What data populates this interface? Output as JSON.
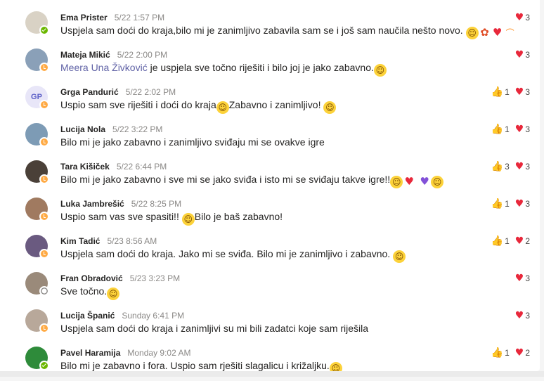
{
  "messages": [
    {
      "name": "Ema Prister",
      "time": "5/22 1:57 PM",
      "status": "available",
      "avatar_color": "#d9d2c5",
      "body": [
        {
          "t": "text",
          "v": "Uspjela sam doći do kraja,bilo mi je zanimljivo zabavila sam se i još sam naučila nešto novo. "
        },
        {
          "t": "emoji",
          "icon": "slightly-smiling-face-emoji",
          "glyph": "☺",
          "cls": "smile"
        },
        {
          "t": "emoji",
          "icon": "flower-emoji",
          "glyph": "✿",
          "cls": "flower"
        },
        {
          "t": "emoji",
          "icon": "heart-emoji",
          "glyph": "♥",
          "cls": "heart"
        },
        {
          "t": "emoji",
          "icon": "rainbow-emoji",
          "glyph": "⌒",
          "cls": "rainbow"
        }
      ],
      "reactions": [
        {
          "type": "heart",
          "count": "3"
        }
      ]
    },
    {
      "name": "Mateja Mikić",
      "time": "5/22 2:00 PM",
      "status": "away",
      "avatar_color": "#8aa0b8",
      "body": [
        {
          "t": "mention",
          "v": "Meera Una Živković"
        },
        {
          "t": "text",
          "v": " je uspjela sve točno riješiti i bilo joj je jako zabavno."
        },
        {
          "t": "emoji",
          "icon": "slightly-smiling-face-emoji",
          "glyph": "☺",
          "cls": "smile"
        }
      ],
      "reactions": [
        {
          "type": "heart",
          "count": "3"
        }
      ]
    },
    {
      "name": "Grga Pandurić",
      "time": "5/22 2:02 PM",
      "status": "away",
      "avatar_initials": "GP",
      "avatar_color": "#e8e6f8",
      "body": [
        {
          "t": "text",
          "v": "Uspio sam sve riješiti i doći do kraja"
        },
        {
          "t": "emoji",
          "icon": "slightly-smiling-face-emoji",
          "glyph": "☺",
          "cls": "smile"
        },
        {
          "t": "text",
          "v": "Zabavno i zanimljivo! "
        },
        {
          "t": "emoji",
          "icon": "slightly-smiling-face-emoji",
          "glyph": "☺",
          "cls": "smile"
        }
      ],
      "reactions": [
        {
          "type": "like",
          "count": "1"
        },
        {
          "type": "heart",
          "count": "3"
        }
      ]
    },
    {
      "name": "Lucija Nola",
      "time": "5/22 3:22 PM",
      "status": "away",
      "avatar_color": "#7d9bb5",
      "body": [
        {
          "t": "text",
          "v": "Bilo mi je jako zabavno i zanimljivo sviđaju mi se ovakve igre"
        }
      ],
      "reactions": [
        {
          "type": "like",
          "count": "1"
        },
        {
          "type": "heart",
          "count": "3"
        }
      ]
    },
    {
      "name": "Tara Kišiček",
      "time": "5/22 6:44 PM",
      "status": "away",
      "avatar_color": "#4a4038",
      "body": [
        {
          "t": "text",
          "v": "Bilo mi je jako zabavno i sve mi se jako sviđa i isto mi se sviđaju takve igre!!"
        },
        {
          "t": "emoji",
          "icon": "smiling-face-with-halo-emoji",
          "glyph": "☺",
          "cls": "smile"
        },
        {
          "t": "emoji",
          "icon": "heart-with-ribbon-emoji",
          "glyph": "♥",
          "cls": "heart"
        },
        {
          "t": "text",
          "v": " "
        },
        {
          "t": "emoji",
          "icon": "purple-heart-emoji",
          "glyph": "♥",
          "cls": "purple"
        },
        {
          "t": "emoji",
          "icon": "smiling-face-with-halo-emoji",
          "glyph": "☺",
          "cls": "smile"
        }
      ],
      "reactions": [
        {
          "type": "like",
          "count": "3"
        },
        {
          "type": "heart",
          "count": "3"
        }
      ]
    },
    {
      "name": "Luka Jambrešić",
      "time": "5/22 8:25 PM",
      "status": "away",
      "avatar_color": "#a07a60",
      "body": [
        {
          "t": "text",
          "v": "Uspio sam vas sve spasiti!! "
        },
        {
          "t": "emoji",
          "icon": "smiling-cat-face-emoji",
          "glyph": "☺",
          "cls": "smile"
        },
        {
          "t": "text",
          "v": "Bilo je baš zabavno!"
        }
      ],
      "reactions": [
        {
          "type": "like",
          "count": "1"
        },
        {
          "type": "heart",
          "count": "3"
        }
      ]
    },
    {
      "name": "Kim Tadić",
      "time": "5/23 8:56 AM",
      "status": "away",
      "avatar_color": "#6a5a80",
      "body": [
        {
          "t": "text",
          "v": "Uspjela sam doći do kraja. Jako mi se sviđa. Bilo mi je zanimljivo i zabavno. "
        },
        {
          "t": "emoji",
          "icon": "slightly-smiling-face-emoji",
          "glyph": "☺",
          "cls": "smile"
        }
      ],
      "reactions": [
        {
          "type": "like",
          "count": "1"
        },
        {
          "type": "heart",
          "count": "2"
        }
      ]
    },
    {
      "name": "Fran Obradović",
      "time": "5/23 3:23 PM",
      "status": "offline",
      "avatar_color": "#9a8a7a",
      "body": [
        {
          "t": "text",
          "v": "Sve točno."
        },
        {
          "t": "emoji",
          "icon": "slightly-smiling-face-emoji",
          "glyph": "☺",
          "cls": "smile"
        }
      ],
      "reactions": [
        {
          "type": "heart",
          "count": "3"
        }
      ]
    },
    {
      "name": "Lucija Španić",
      "time": "Sunday 6:41 PM",
      "status": "away",
      "avatar_color": "#b8a89a",
      "body": [
        {
          "t": "text",
          "v": "Uspjela sam doći do kraja i zanimljivi su mi bili zadatci koje sam riješila"
        }
      ],
      "reactions": [
        {
          "type": "heart",
          "count": "3"
        }
      ]
    },
    {
      "name": "Pavel Haramija",
      "time": "Monday 9:02 AM",
      "status": "available",
      "avatar_color": "#2e8b3a",
      "body": [
        {
          "t": "text",
          "v": "Bilo mi je zabavno i fora. Uspio sam rješiti slagalicu i križaljku."
        },
        {
          "t": "emoji",
          "icon": "face-with-tears-of-joy-emoji",
          "glyph": "☺",
          "cls": "smile"
        }
      ],
      "reactions": [
        {
          "type": "like",
          "count": "1"
        },
        {
          "type": "heart",
          "count": "2"
        }
      ]
    }
  ],
  "reaction_glyphs": {
    "like": "👍",
    "heart": "♥"
  },
  "colors": {
    "accent": "#6264a7",
    "heart": "#e8283b",
    "like": "#f2b01e",
    "available": "#6bb700",
    "away": "#ffaa44"
  }
}
